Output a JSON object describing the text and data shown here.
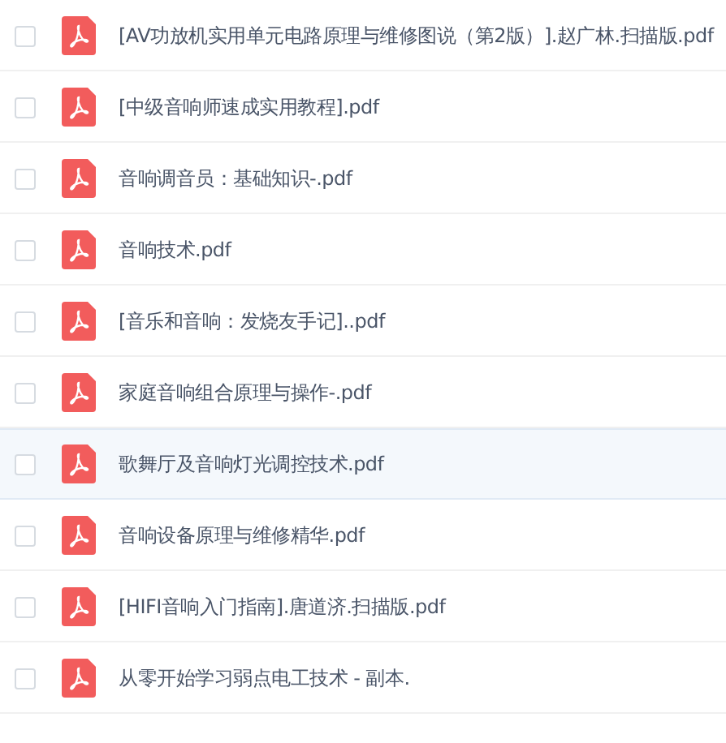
{
  "files": [
    {
      "name": "[AV功放机实用单元电路原理与维修图说（第2版）].赵广林.扫描版.pdf",
      "checked": false,
      "hovered": false
    },
    {
      "name": "[中级音响师速成实用教程].pdf",
      "checked": false,
      "hovered": false
    },
    {
      "name": "音响调音员：基础知识-.pdf",
      "checked": false,
      "hovered": false
    },
    {
      "name": "音响技术.pdf",
      "checked": false,
      "hovered": false
    },
    {
      "name": "[音乐和音响：发烧友手记]..pdf",
      "checked": false,
      "hovered": false
    },
    {
      "name": "家庭音响组合原理与操作-.pdf",
      "checked": false,
      "hovered": false
    },
    {
      "name": "歌舞厅及音响灯光调控技术.pdf",
      "checked": false,
      "hovered": true
    },
    {
      "name": "音响设备原理与维修精华.pdf",
      "checked": false,
      "hovered": false
    },
    {
      "name": "[HIFI音响入门指南].唐道济.扫描版.pdf",
      "checked": false,
      "hovered": false
    },
    {
      "name": "从零开始学习弱点电工技术 - 副本.",
      "checked": false,
      "hovered": false
    }
  ]
}
